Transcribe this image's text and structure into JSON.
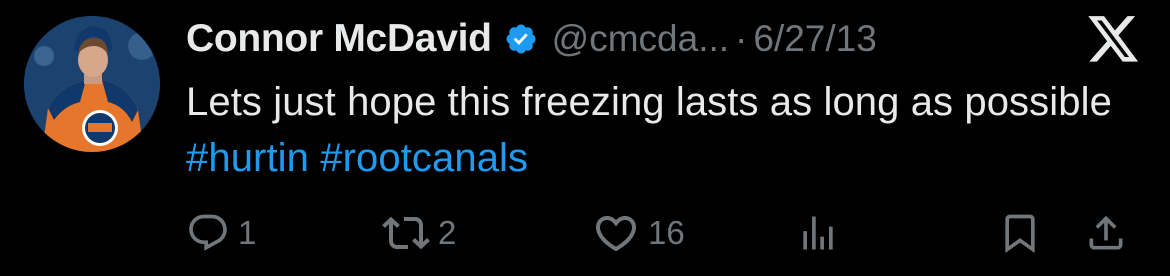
{
  "tweet": {
    "author": {
      "name": "Connor McDavid",
      "handle": "@cmcda...",
      "verified": true,
      "avatar_icon": "hockey-player-avatar-icon"
    },
    "separator": "·",
    "date": "6/27/13",
    "text_plain": "Lets just hope this freezing lasts as long as possible",
    "hashtags": [
      "#hurtin",
      "#rootcanals"
    ],
    "platform_icon": "x-logo-icon"
  },
  "actions": {
    "reply": {
      "icon": "reply-icon",
      "count": "1"
    },
    "retweet": {
      "icon": "retweet-icon",
      "count": "2"
    },
    "like": {
      "icon": "heart-icon",
      "count": "16"
    },
    "views": {
      "icon": "analytics-icon"
    },
    "bookmark": {
      "icon": "bookmark-icon"
    },
    "share": {
      "icon": "share-icon"
    }
  },
  "colors": {
    "background": "#000000",
    "text": "#e7e9ea",
    "secondary": "#71767b",
    "accent": "#1d9bf0"
  }
}
